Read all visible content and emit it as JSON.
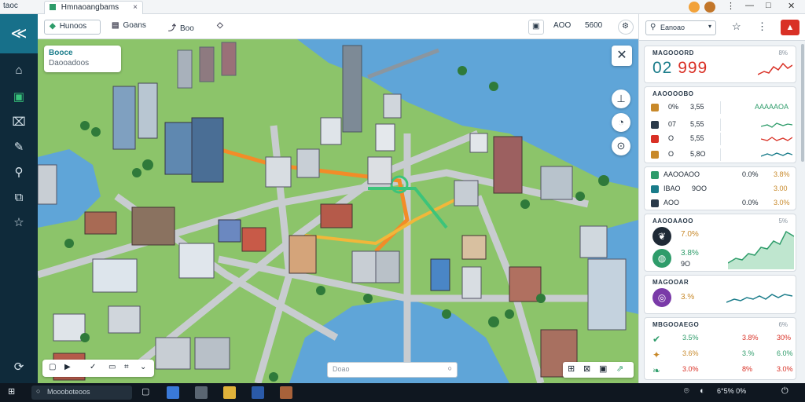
{
  "titlebar": {
    "app_label": "taoc",
    "tab_label": "Hmnaoangbams",
    "tab_close": "×",
    "min": "—",
    "max": "□",
    "close": "✕"
  },
  "sidebar": {
    "logo": "≪",
    "items": [
      {
        "icon": "home-icon",
        "glyph": "⌂",
        "active": false
      },
      {
        "icon": "map-icon",
        "glyph": "▣",
        "active": true
      },
      {
        "icon": "building-icon",
        "glyph": "⌧",
        "active": false
      },
      {
        "icon": "edit-icon",
        "glyph": "✎",
        "active": false
      },
      {
        "icon": "pin-icon",
        "glyph": "⚲",
        "active": false
      },
      {
        "icon": "layers-icon",
        "glyph": "⧉",
        "active": false
      },
      {
        "icon": "star-icon",
        "glyph": "☆",
        "active": false
      }
    ],
    "bottom_icon": "⟳"
  },
  "toolbar": {
    "main_button": "Hunoos",
    "btn2": "Goans",
    "btn3": "Boo",
    "right1": "",
    "right2": "AOO",
    "right3": "5600"
  },
  "map": {
    "card_line1": "Booce",
    "card_line2": "Daooadoos",
    "search_placeholder": "Doao",
    "colors": {
      "water": "#5fa5d8",
      "land": "#8cc46a",
      "road": "#c8ccd0",
      "route": "#f28c28",
      "route2": "#3cc47a"
    }
  },
  "panel": {
    "search_value": "Eanoao",
    "card1": {
      "title": "MAGOOORD",
      "pct": "8%",
      "big_a": "02",
      "big_b": "999"
    },
    "card2": {
      "title": "AAOOOOBO",
      "rows": [
        {
          "c1": "0%",
          "c2": "3,55",
          "c3": "AAAAAOA"
        },
        {
          "c1": "07",
          "c2": "5,55",
          "c3": ""
        },
        {
          "c1": "O",
          "c2": "5,55",
          "c3": ""
        },
        {
          "c1": "O",
          "c2": "5,8O",
          "c3": ""
        }
      ]
    },
    "card3": {
      "rows": [
        {
          "label": "AAOOAOO",
          "c2": "0.0%",
          "c3": "3.8%"
        },
        {
          "label": "IBAO",
          "c2": "9OO",
          "c3": "3.00"
        },
        {
          "label": "AOO",
          "c2": "0.0%",
          "c3": "3.0%"
        }
      ]
    },
    "card4": {
      "title": "AAOOAAOO",
      "pct": "5%",
      "v1": "7.0%",
      "v2": "3.8%",
      "v3": "9O"
    },
    "card5": {
      "title": "MAGOOAR",
      "pct": "",
      "v1": "3.%"
    },
    "card6": {
      "title": "MBGOOAEGO",
      "pct": "6%",
      "rows": [
        {
          "c1": "3.5%",
          "c2": "3.8%",
          "c3": "30%"
        },
        {
          "c1": "3.6%",
          "c2": "3.%",
          "c3": "6.0%"
        },
        {
          "c1": "3.0%",
          "c2": "8%",
          "c3": "3.0%"
        }
      ]
    }
  },
  "taskbar": {
    "search_text": "Moooboteoos",
    "tray_text": "6°5% 0%"
  }
}
